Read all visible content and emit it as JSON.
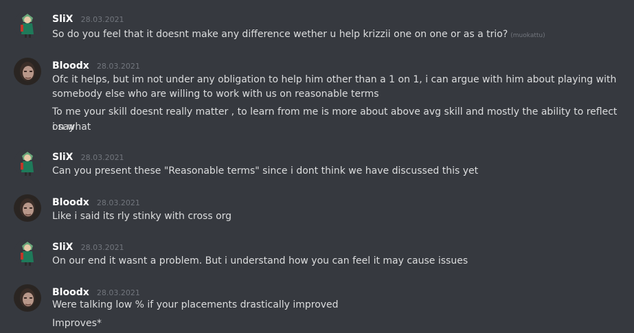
{
  "messages": [
    {
      "author": "SliX",
      "avatar_icon": "anime-character-avatar",
      "timestamp": "28.03.2021",
      "lines": [
        "So do you feel that it doesnt make any difference wether u help krizzii one on one or as a trio?"
      ],
      "edited_label": "(muokattu)"
    },
    {
      "author": "Bloodx",
      "avatar_icon": "person-photo-avatar",
      "timestamp": "28.03.2021",
      "lines": [
        "Ofc it helps, but im not under any obligation to help him other than a 1 on 1, i can argue with him about playing with",
        "somebody else who are willing to work with us on reasonable terms",
        "To me your skill doesnt really matter , to learn from me is more about above avg skill and mostly the ability to reflect on what",
        "i say"
      ]
    },
    {
      "author": "SliX",
      "avatar_icon": "anime-character-avatar",
      "timestamp": "28.03.2021",
      "lines": [
        "Can you present these \"Reasonable terms\" since i dont think we have discussed this yet"
      ]
    },
    {
      "author": "Bloodx",
      "avatar_icon": "person-photo-avatar",
      "timestamp": "28.03.2021",
      "lines": [
        "Like i said its rly stinky with cross org"
      ]
    },
    {
      "author": "SliX",
      "avatar_icon": "anime-character-avatar",
      "timestamp": "28.03.2021",
      "lines": [
        "On our end it wasnt a problem. But i understand how you can feel it may cause issues"
      ]
    },
    {
      "author": "Bloodx",
      "avatar_icon": "person-photo-avatar",
      "timestamp": "28.03.2021",
      "lines": [
        "Were talking low % if your placements drastically improved",
        "Improves*"
      ]
    }
  ],
  "colors": {
    "background": "#36393f",
    "username": "#ffffff",
    "text": "#dcddde",
    "muted": "#72767d"
  }
}
